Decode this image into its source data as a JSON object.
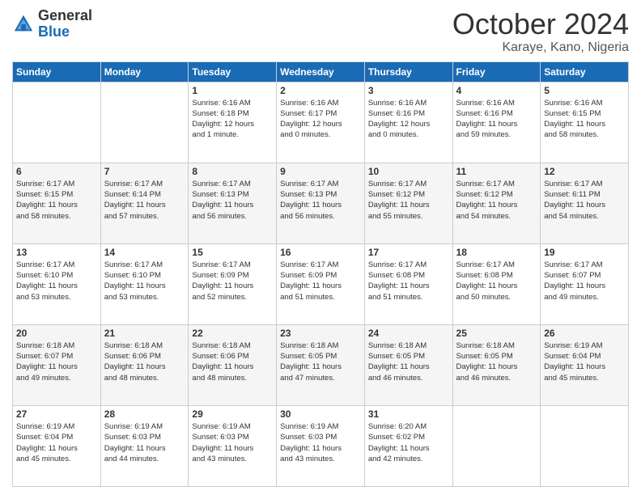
{
  "logo": {
    "general": "General",
    "blue": "Blue"
  },
  "header": {
    "title": "October 2024",
    "subtitle": "Karaye, Kano, Nigeria"
  },
  "days_of_week": [
    "Sunday",
    "Monday",
    "Tuesday",
    "Wednesday",
    "Thursday",
    "Friday",
    "Saturday"
  ],
  "weeks": [
    [
      {
        "day": "",
        "info": ""
      },
      {
        "day": "",
        "info": ""
      },
      {
        "day": "1",
        "info": "Sunrise: 6:16 AM\nSunset: 6:18 PM\nDaylight: 12 hours\nand 1 minute."
      },
      {
        "day": "2",
        "info": "Sunrise: 6:16 AM\nSunset: 6:17 PM\nDaylight: 12 hours\nand 0 minutes."
      },
      {
        "day": "3",
        "info": "Sunrise: 6:16 AM\nSunset: 6:16 PM\nDaylight: 12 hours\nand 0 minutes."
      },
      {
        "day": "4",
        "info": "Sunrise: 6:16 AM\nSunset: 6:16 PM\nDaylight: 11 hours\nand 59 minutes."
      },
      {
        "day": "5",
        "info": "Sunrise: 6:16 AM\nSunset: 6:15 PM\nDaylight: 11 hours\nand 58 minutes."
      }
    ],
    [
      {
        "day": "6",
        "info": "Sunrise: 6:17 AM\nSunset: 6:15 PM\nDaylight: 11 hours\nand 58 minutes."
      },
      {
        "day": "7",
        "info": "Sunrise: 6:17 AM\nSunset: 6:14 PM\nDaylight: 11 hours\nand 57 minutes."
      },
      {
        "day": "8",
        "info": "Sunrise: 6:17 AM\nSunset: 6:13 PM\nDaylight: 11 hours\nand 56 minutes."
      },
      {
        "day": "9",
        "info": "Sunrise: 6:17 AM\nSunset: 6:13 PM\nDaylight: 11 hours\nand 56 minutes."
      },
      {
        "day": "10",
        "info": "Sunrise: 6:17 AM\nSunset: 6:12 PM\nDaylight: 11 hours\nand 55 minutes."
      },
      {
        "day": "11",
        "info": "Sunrise: 6:17 AM\nSunset: 6:12 PM\nDaylight: 11 hours\nand 54 minutes."
      },
      {
        "day": "12",
        "info": "Sunrise: 6:17 AM\nSunset: 6:11 PM\nDaylight: 11 hours\nand 54 minutes."
      }
    ],
    [
      {
        "day": "13",
        "info": "Sunrise: 6:17 AM\nSunset: 6:10 PM\nDaylight: 11 hours\nand 53 minutes."
      },
      {
        "day": "14",
        "info": "Sunrise: 6:17 AM\nSunset: 6:10 PM\nDaylight: 11 hours\nand 53 minutes."
      },
      {
        "day": "15",
        "info": "Sunrise: 6:17 AM\nSunset: 6:09 PM\nDaylight: 11 hours\nand 52 minutes."
      },
      {
        "day": "16",
        "info": "Sunrise: 6:17 AM\nSunset: 6:09 PM\nDaylight: 11 hours\nand 51 minutes."
      },
      {
        "day": "17",
        "info": "Sunrise: 6:17 AM\nSunset: 6:08 PM\nDaylight: 11 hours\nand 51 minutes."
      },
      {
        "day": "18",
        "info": "Sunrise: 6:17 AM\nSunset: 6:08 PM\nDaylight: 11 hours\nand 50 minutes."
      },
      {
        "day": "19",
        "info": "Sunrise: 6:17 AM\nSunset: 6:07 PM\nDaylight: 11 hours\nand 49 minutes."
      }
    ],
    [
      {
        "day": "20",
        "info": "Sunrise: 6:18 AM\nSunset: 6:07 PM\nDaylight: 11 hours\nand 49 minutes."
      },
      {
        "day": "21",
        "info": "Sunrise: 6:18 AM\nSunset: 6:06 PM\nDaylight: 11 hours\nand 48 minutes."
      },
      {
        "day": "22",
        "info": "Sunrise: 6:18 AM\nSunset: 6:06 PM\nDaylight: 11 hours\nand 48 minutes."
      },
      {
        "day": "23",
        "info": "Sunrise: 6:18 AM\nSunset: 6:05 PM\nDaylight: 11 hours\nand 47 minutes."
      },
      {
        "day": "24",
        "info": "Sunrise: 6:18 AM\nSunset: 6:05 PM\nDaylight: 11 hours\nand 46 minutes."
      },
      {
        "day": "25",
        "info": "Sunrise: 6:18 AM\nSunset: 6:05 PM\nDaylight: 11 hours\nand 46 minutes."
      },
      {
        "day": "26",
        "info": "Sunrise: 6:19 AM\nSunset: 6:04 PM\nDaylight: 11 hours\nand 45 minutes."
      }
    ],
    [
      {
        "day": "27",
        "info": "Sunrise: 6:19 AM\nSunset: 6:04 PM\nDaylight: 11 hours\nand 45 minutes."
      },
      {
        "day": "28",
        "info": "Sunrise: 6:19 AM\nSunset: 6:03 PM\nDaylight: 11 hours\nand 44 minutes."
      },
      {
        "day": "29",
        "info": "Sunrise: 6:19 AM\nSunset: 6:03 PM\nDaylight: 11 hours\nand 43 minutes."
      },
      {
        "day": "30",
        "info": "Sunrise: 6:19 AM\nSunset: 6:03 PM\nDaylight: 11 hours\nand 43 minutes."
      },
      {
        "day": "31",
        "info": "Sunrise: 6:20 AM\nSunset: 6:02 PM\nDaylight: 11 hours\nand 42 minutes."
      },
      {
        "day": "",
        "info": ""
      },
      {
        "day": "",
        "info": ""
      }
    ]
  ]
}
